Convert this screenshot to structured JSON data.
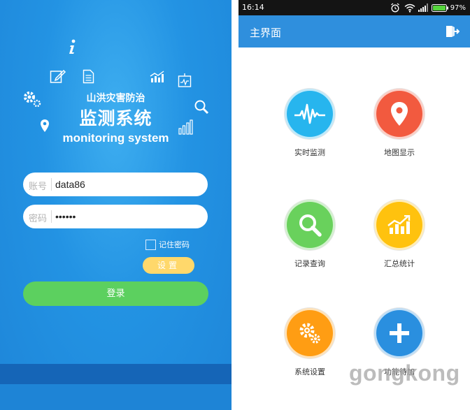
{
  "login": {
    "subtitle": "山洪灾害防治",
    "title": "监测系统",
    "title_en": "monitoring system",
    "account_label": "账号",
    "account_value": "data86",
    "password_label": "密码",
    "password_value": "123456",
    "remember_label": "记住密码",
    "settings_label": "设置",
    "login_label": "登录",
    "colors": {
      "login_button": "#5cd05f",
      "settings_button": "#ffd86b",
      "background": "#2393e3"
    }
  },
  "statusbar": {
    "time": "16:14",
    "battery": "97%"
  },
  "main": {
    "title": "主界面",
    "tiles": [
      {
        "label": "实时监测",
        "icon": "pulse-icon",
        "color": "#27b5ee"
      },
      {
        "label": "地图显示",
        "icon": "map-pin-icon",
        "color": "#f25a3f"
      },
      {
        "label": "记录查询",
        "icon": "search-icon",
        "color": "#69d15c"
      },
      {
        "label": "汇总统计",
        "icon": "chart-icon",
        "color": "#ffc20e"
      },
      {
        "label": "系统设置",
        "icon": "gears-icon",
        "color": "#ff9d13"
      },
      {
        "label": "功能待加",
        "icon": "plus-icon",
        "color": "#2a8fdf"
      }
    ]
  },
  "watermark": "gongkong"
}
